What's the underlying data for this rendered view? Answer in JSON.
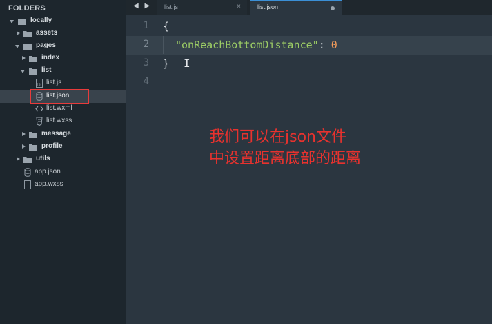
{
  "sidebar": {
    "title": "FOLDERS",
    "tree": [
      {
        "label": "locally",
        "type": "folder"
      },
      {
        "label": "assets",
        "type": "folder"
      },
      {
        "label": "pages",
        "type": "folder"
      },
      {
        "label": "index",
        "type": "folder"
      },
      {
        "label": "list",
        "type": "folder"
      },
      {
        "label": "list.js",
        "type": "file"
      },
      {
        "label": "list.json",
        "type": "file"
      },
      {
        "label": "list.wxml",
        "type": "file"
      },
      {
        "label": "list.wxss",
        "type": "file"
      },
      {
        "label": "message",
        "type": "folder"
      },
      {
        "label": "profile",
        "type": "folder"
      },
      {
        "label": "utils",
        "type": "folder"
      },
      {
        "label": "app.json",
        "type": "file"
      },
      {
        "label": "app.wxss",
        "type": "file"
      }
    ]
  },
  "tabs": {
    "nav_arrows": "◀ ▶",
    "items": [
      {
        "label": "list.js",
        "close": "×"
      },
      {
        "label": "list.json"
      }
    ]
  },
  "editor": {
    "line_numbers": [
      "1",
      "2",
      "3",
      "4"
    ],
    "lines": {
      "l1": "{",
      "l2_key": "\"onReachBottomDistance\"",
      "l2_colon": ": ",
      "l2_value": "0",
      "l3": "}"
    },
    "cursor": "I"
  },
  "annotation": "我们可以在json文件中设置距离底部的距离",
  "colors": {
    "highlight_box": "#e83b3b",
    "annotation_text": "#e8322e",
    "active_tab_accent": "#3b8fd6"
  }
}
